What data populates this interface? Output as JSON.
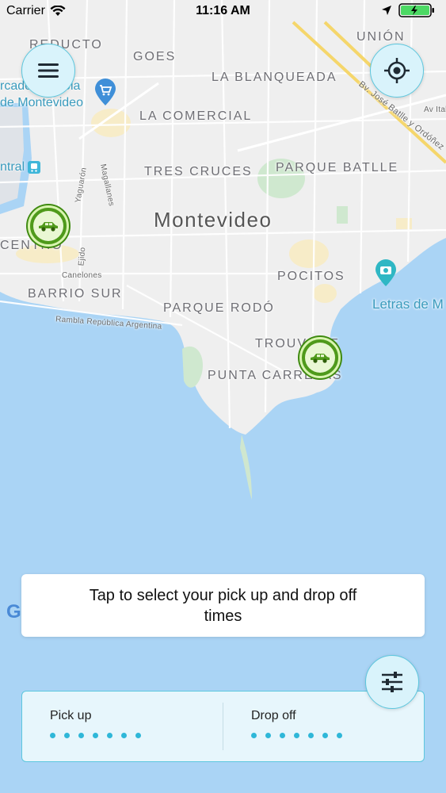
{
  "status": {
    "carrier": "Carrier",
    "time": "11:16 AM"
  },
  "map": {
    "city": "Montevideo",
    "labels": {
      "reducto": "REDUCTO",
      "goes": "GOES",
      "union": "UNIÓN",
      "la_blanqueada": "LA BLANQUEADA",
      "la_comercial": "LA COMERCIAL",
      "tres_cruces": "TRES CRUCES",
      "parque_batlle": "PARQUE BATLLE",
      "centro": "CENTRO",
      "barrio_sur": "BARRIO SUR",
      "pocitos": "POCITOS",
      "parque_rodo": "PARQUE RODÓ",
      "trouville": "TROUVILLE",
      "punta_carretas": "PUNTA CARRETAS",
      "mercado": "rcado Agricola",
      "de_montevideo": "de Montevideo",
      "central": "ntral",
      "letras": "Letras de M",
      "canelones": "Canelones",
      "rambla": "Rambla República Argentina",
      "av_batlle": "Bv. José Batlle y Ordóñez",
      "av_ital": "Av Ital",
      "yaguaron": "Yaguarón",
      "magallanes": "Magallanes",
      "ejido": "Ejido"
    },
    "google_mark": "G"
  },
  "hint": {
    "text": "Tap to select your pick up and drop off times"
  },
  "times": {
    "pickup_label": "Pick up",
    "dropoff_label": "Drop off"
  },
  "colors": {
    "accent": "#5cc7de",
    "dot": "#2fb7d8",
    "car_green": "#4f9a1b",
    "water": "#aad4f5",
    "land": "#efefef"
  },
  "icons": {
    "menu": "menu-icon",
    "locate": "crosshair-icon",
    "filter": "sliders-icon",
    "car": "car-icon"
  }
}
